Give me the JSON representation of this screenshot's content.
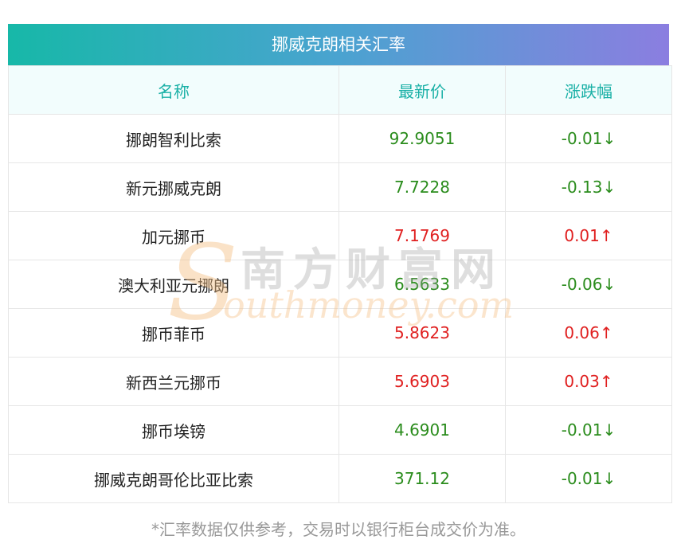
{
  "title": "挪威克朗相关汇率",
  "headers": {
    "name": "名称",
    "price": "最新价",
    "change": "涨跌幅"
  },
  "rows": [
    {
      "name": "挪朗智利比索",
      "price": "92.9051",
      "change": "-0.01↓",
      "trend": "down"
    },
    {
      "name": "新元挪威克朗",
      "price": "7.7228",
      "change": "-0.13↓",
      "trend": "down"
    },
    {
      "name": "加元挪币",
      "price": "7.1769",
      "change": "0.01↑",
      "trend": "up"
    },
    {
      "name": "澳大利亚元挪朗",
      "price": "6.5633",
      "change": "-0.06↓",
      "trend": "down"
    },
    {
      "name": "挪币菲币",
      "price": "5.8623",
      "change": "0.06↑",
      "trend": "up"
    },
    {
      "name": "新西兰元挪币",
      "price": "5.6903",
      "change": "0.03↑",
      "trend": "up"
    },
    {
      "name": "挪币埃镑",
      "price": "4.6901",
      "change": "-0.01↓",
      "trend": "down"
    },
    {
      "name": "挪威克朗哥伦比亚比索",
      "price": "371.12",
      "change": "-0.01↓",
      "trend": "down"
    }
  ],
  "footnote": "*汇率数据仅供参考，交易时以银行柜台成交价为准。",
  "watermark": {
    "cn": "南方财富网",
    "en": "outhmoney.com",
    "s": "S"
  },
  "colors": {
    "up": "#e02020",
    "down": "#2a8c1c",
    "header_text": "#19b0a6"
  }
}
